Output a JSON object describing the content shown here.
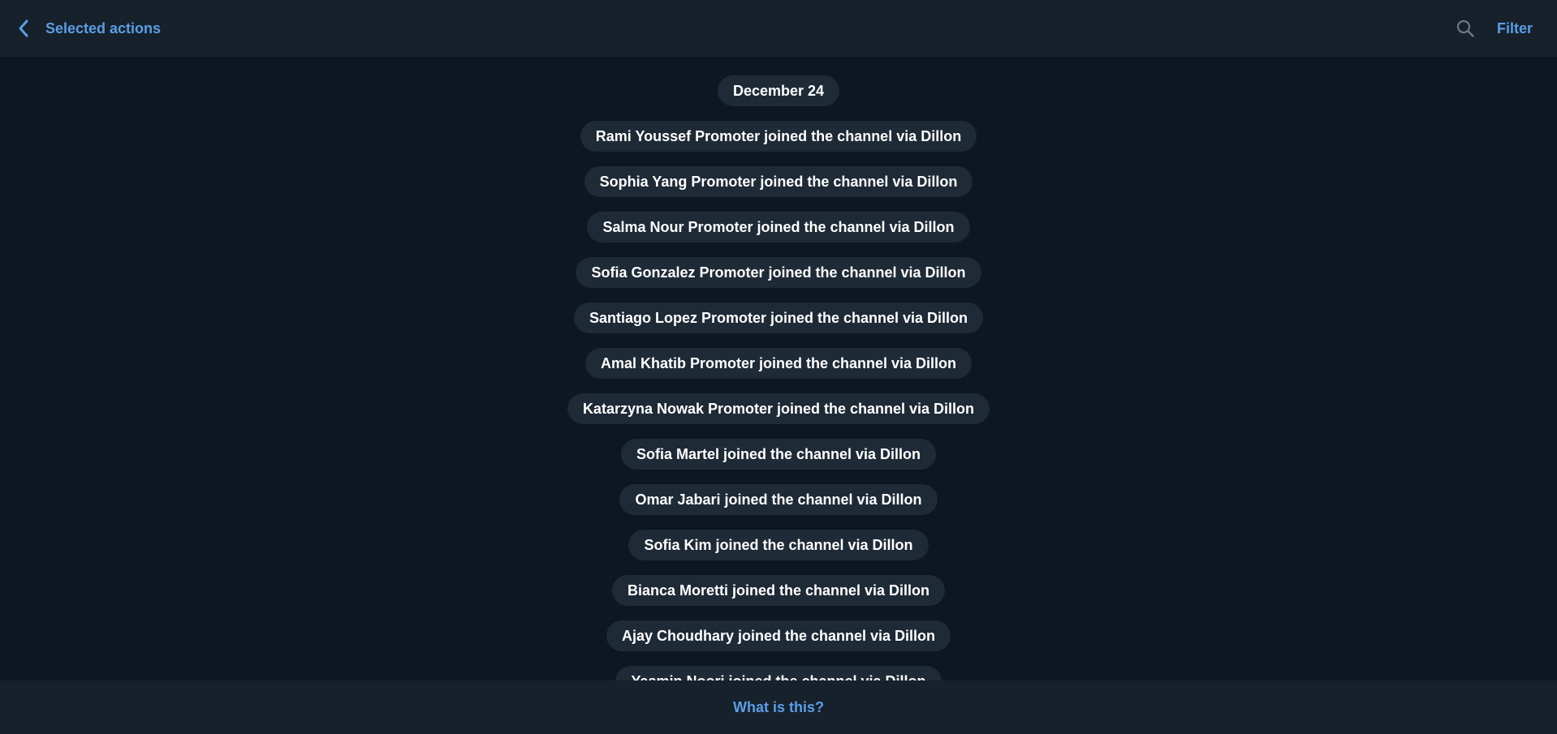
{
  "header": {
    "title": "Selected actions",
    "filter_label": "Filter",
    "back_icon": "chevron-left-icon",
    "search_icon": "search-icon"
  },
  "feed": {
    "date": "December 24",
    "actions": [
      "Rami Youssef Promoter joined the channel via Dillon",
      "Sophia Yang Promoter joined the channel via Dillon",
      "Salma Nour Promoter joined the channel via Dillon",
      "Sofia Gonzalez Promoter joined the channel via Dillon",
      "Santiago Lopez Promoter joined the channel via Dillon",
      "Amal Khatib Promoter joined the channel via Dillon",
      "Katarzyna Nowak Promoter joined the channel via Dillon",
      "Sofia Martel joined the channel via Dillon",
      "Omar Jabari joined the channel via Dillon",
      "Sofia Kim joined the channel via Dillon",
      "Bianca Moretti joined the channel via Dillon",
      "Ajay Choudhary joined the channel via Dillon",
      "Yasmin Noori joined the channel via Dillon"
    ]
  },
  "footer": {
    "link_label": "What is this?"
  },
  "colors": {
    "background": "#0e1621",
    "bar": "#17212b",
    "pill": "#1e2a36",
    "accent": "#5a9ee6",
    "icon_gray": "#6c7883"
  }
}
